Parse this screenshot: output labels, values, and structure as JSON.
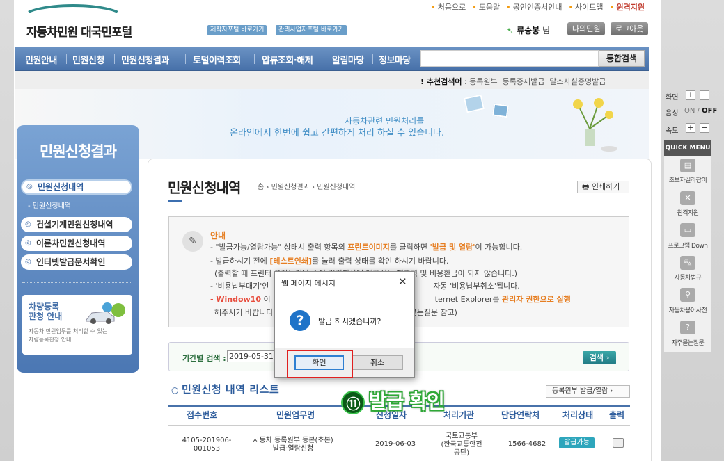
{
  "header": {
    "util_links": [
      "처음으로",
      "도움말",
      "공인인증서안내",
      "사이트맵",
      "원격지원"
    ],
    "site_title": "자동차민원 대국민포털",
    "site_links": [
      "제작자포털 바로가기",
      "관리사업자포털 바로가기"
    ],
    "user_name": "류승봉",
    "user_suffix": "님",
    "my_btn": "나의민원",
    "logout_btn": "로그아웃"
  },
  "nav": {
    "items": [
      "민원안내",
      "민원신청",
      "민원신청결과",
      "토털이력조회",
      "압류조회·해제",
      "알림마당",
      "정보마당"
    ],
    "search_value": "",
    "search_btn": "통합검색",
    "recommend_label": "추천검색어",
    "recommend_words": [
      "등록원부",
      "등록증재발급",
      "말소사실증명발급"
    ]
  },
  "banner": {
    "line1": "자동차관련 민원처리를",
    "line2": "온라인에서 한번에 쉽고 간편하게 처리 하실 수 있습니다."
  },
  "sidebar": {
    "title": "민원신청결과",
    "items": [
      "민원신청내역",
      "건설기계민원신청내역",
      "이륜차민원신청내역",
      "인터넷발급문서확인"
    ],
    "sub_item": "민원신청내역",
    "promo_title": "차량등록\n관청 안내",
    "promo_desc": "자동차 민원업무를 처리할 수 있는\n차량등록관청 안내"
  },
  "right_rail": {
    "screen_label": "화면",
    "voice_label": "음성",
    "voice_on": "ON",
    "voice_sep": "/",
    "voice_off": "OFF",
    "speed_label": "속도",
    "quick_menu": "QUICK MENU",
    "quick_items": [
      "초보자길라잡이",
      "원격지원",
      "프로그램 Down",
      "자동차법규",
      "자동차용어사전",
      "자주묻는질문"
    ]
  },
  "content": {
    "title": "민원신청내역",
    "breadcrumb": [
      "홈",
      "민원신청결과",
      "민원신청내역"
    ],
    "print_btn": "인쇄하기",
    "notice_title": "안내",
    "notice": {
      "l1a": "- \"발급가능/열람가능\" 상태시 출력 항목의 ",
      "l1b": "프린트이미지",
      "l1c": "를 클릭하면 ",
      "l1d": "'발급 및 열람'",
      "l1e": "이 가능합니다.",
      "l2a": "- 발급하시기 전에 ",
      "l2b": "[테스트인쇄]",
      "l2c": "를 눌러 출력 상태를 확인 하시기 바랍니다.",
      "l3": "(출력할 때 프린터 오작동이나 종이 걸림현상에 대해서는 재출력 및 비용환급이 되지 않습니다.)",
      "l4a": "- '비용납부대기'인",
      "l4b": "자동 '비용납부취소'됩니다.",
      "l5a": "- Window10",
      "l5b": " 이",
      "l5c": "ternet Explorer를 ",
      "l5d": "관리자 권한으로 실행",
      "l6a": "해주시기 바랍니다",
      "l6b": "묻는질문 참고)"
    },
    "period_label": "기간별 검색 :",
    "date_from": "2019-05-31",
    "search_btn": "검색",
    "list_title": "민원신청 내역 리스트",
    "list_btn": "등록원부 발급/열람",
    "columns": [
      "접수번호",
      "민원업무명",
      "신청일자",
      "처리기관",
      "담당연락처",
      "처리상태",
      "출력"
    ],
    "row": {
      "receipt_no": "4105-201906-\n001053",
      "task": "자동차 등록원부 등본(초본)\n발급·열람신청",
      "date": "2019-06-03",
      "agency": "국토교통부\n(한국교통안전\n공단)",
      "contact": "1566-4682",
      "status": "발급가능"
    }
  },
  "dialog": {
    "title": "웹 페이지 메시지",
    "message": "발급 하시겠습니까?",
    "ok": "확인",
    "cancel": "취소"
  },
  "annotation": {
    "number": "⑪",
    "text": "발급 확인"
  }
}
